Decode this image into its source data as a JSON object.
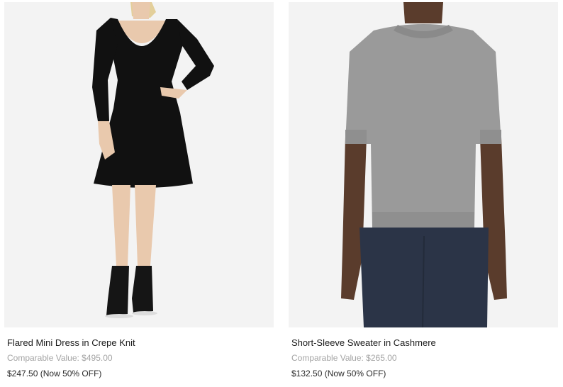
{
  "products": [
    {
      "name": "Flared Mini Dress in Crepe Knit",
      "comparable": "Comparable Value: $495.00",
      "price": "$247.50",
      "discount": "(Now 50% OFF)",
      "image_icon": "dress-product-image"
    },
    {
      "name": "Short-Sleeve Sweater in Cashmere",
      "comparable": "Comparable Value: $265.00",
      "price": "$132.50",
      "discount": "(Now 50% OFF)",
      "image_icon": "sweater-product-image"
    }
  ],
  "colors": {
    "image_bg": "#f3f3f3",
    "muted_text": "#a4a4a4",
    "dress": "#111111",
    "sweater": "#9a9a9a",
    "trousers": "#2b3447"
  }
}
